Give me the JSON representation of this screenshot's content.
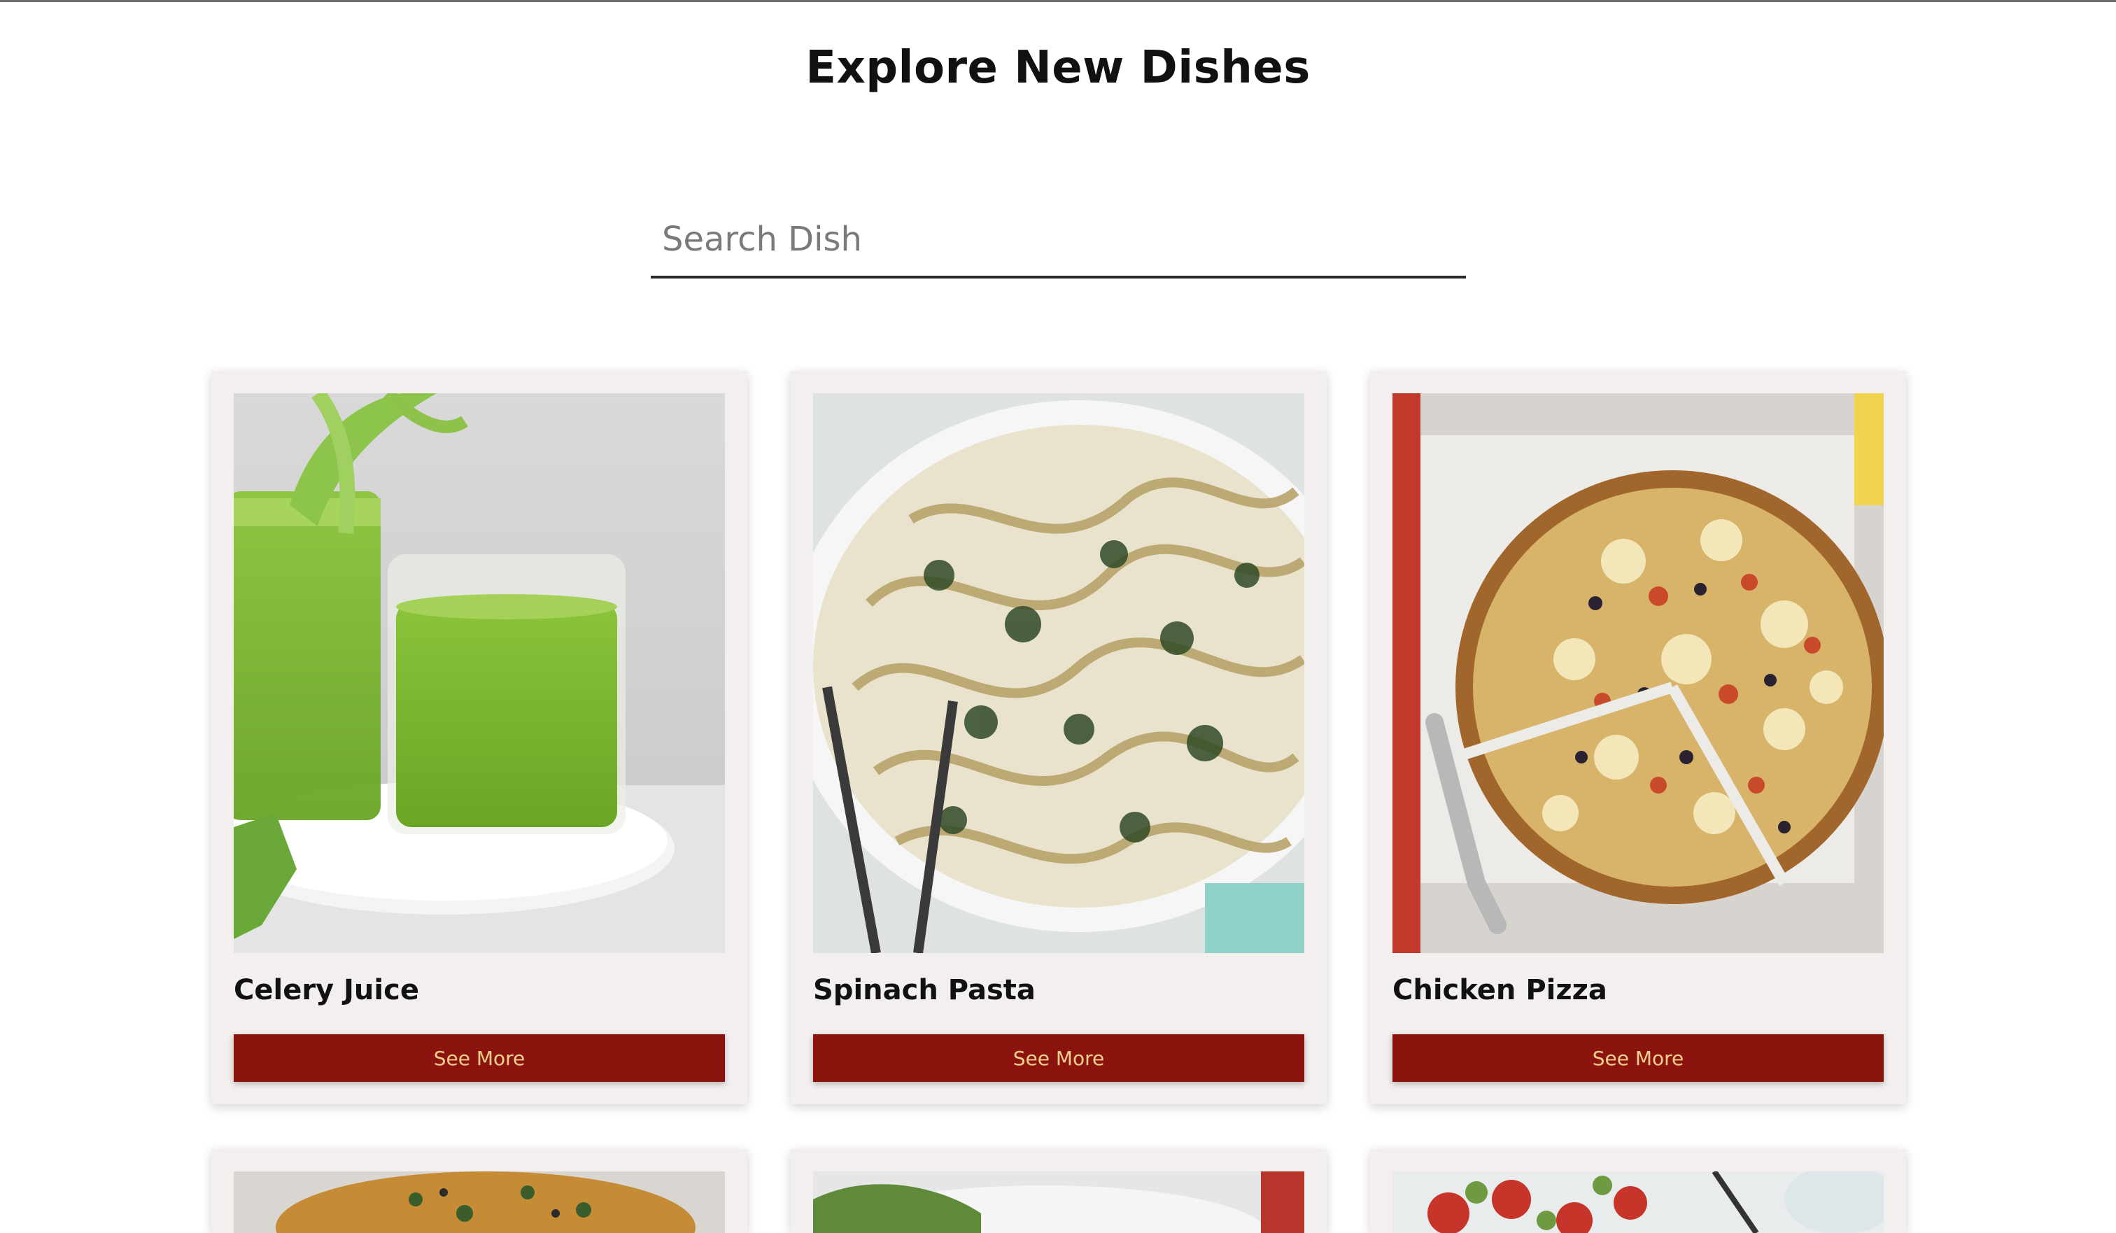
{
  "page": {
    "title": "Explore New Dishes"
  },
  "search": {
    "placeholder": "Search Dish",
    "value": ""
  },
  "dishes": [
    {
      "name": "Celery Juice",
      "button_label": "See More",
      "image": "green-celery-juice-photo"
    },
    {
      "name": "Spinach Pasta",
      "button_label": "See More",
      "image": "spinach-fettuccine-pan-photo"
    },
    {
      "name": "Chicken Pizza",
      "button_label": "See More",
      "image": "chicken-pizza-sliced-photo"
    },
    {
      "name": "",
      "button_label": "",
      "image": "herb-flatbread-photo"
    },
    {
      "name": "",
      "button_label": "",
      "image": "leafy-dish-photo"
    },
    {
      "name": "",
      "button_label": "",
      "image": "tomato-salad-photo"
    }
  ],
  "colors": {
    "button_bg": "#8b150e",
    "button_text": "#f3cf8e",
    "card_bg": "#f2efee"
  }
}
